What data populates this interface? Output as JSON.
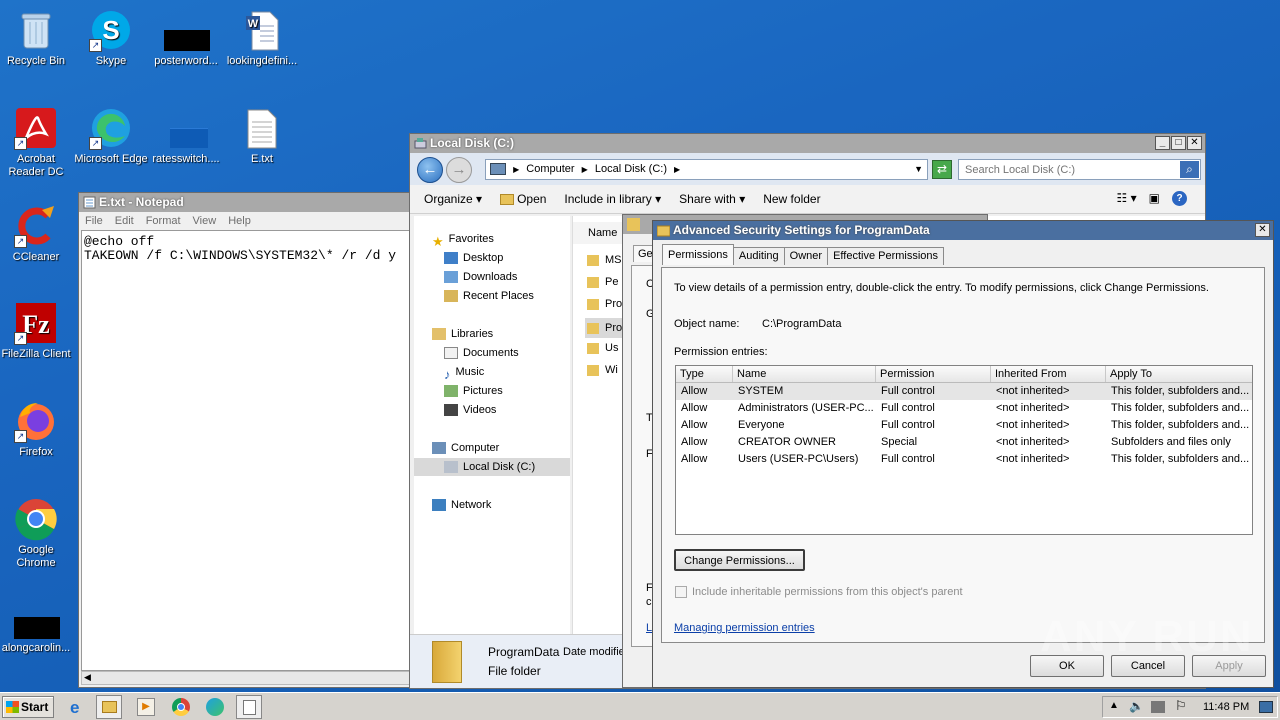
{
  "desktop_icons": [
    {
      "label": "Recycle Bin",
      "icon": "recycle-bin-icon"
    },
    {
      "label": "Skype",
      "icon": "skype-icon"
    },
    {
      "label": "posterword...",
      "icon": "redacted-file-icon"
    },
    {
      "label": "lookingdefini...",
      "icon": "word-document-icon"
    },
    {
      "label": "Acrobat Reader DC",
      "icon": "acrobat-icon"
    },
    {
      "label": "Microsoft Edge",
      "icon": "edge-icon"
    },
    {
      "label": "ratesswitch....",
      "icon": "blank-file-icon"
    },
    {
      "label": "E.txt",
      "icon": "text-file-icon"
    },
    {
      "label": "CCleaner",
      "icon": "ccleaner-icon"
    },
    {
      "label": "FileZilla Client",
      "icon": "filezilla-icon"
    },
    {
      "label": "Firefox",
      "icon": "firefox-icon"
    },
    {
      "label": "Google Chrome",
      "icon": "chrome-icon"
    },
    {
      "label": "alongcarolin...",
      "icon": "redacted-file-icon"
    }
  ],
  "notepad": {
    "title": "E.txt - Notepad",
    "menu": [
      "File",
      "Edit",
      "Format",
      "View",
      "Help"
    ],
    "content": "@echo off\nTAKEOWN /f C:\\WINDOWS\\SYSTEM32\\* /r /d y"
  },
  "explorer": {
    "title": "Local Disk (C:)",
    "breadcrumb": [
      "Computer",
      "Local Disk (C:)"
    ],
    "search_placeholder": "Search Local Disk (C:)",
    "toolbar": {
      "organize": "Organize",
      "open": "Open",
      "include": "Include in library",
      "share": "Share with",
      "new_folder": "New folder"
    },
    "nav": {
      "favorites": "Favorites",
      "desktop": "Desktop",
      "downloads": "Downloads",
      "recent": "Recent Places",
      "libraries": "Libraries",
      "documents": "Documents",
      "music": "Music",
      "pictures": "Pictures",
      "videos": "Videos",
      "computer": "Computer",
      "local_disk": "Local Disk (C:)",
      "network": "Network"
    },
    "column_name": "Name",
    "files": [
      "MS",
      "Pe",
      "Pro",
      "Pro",
      "Us",
      "Wi"
    ],
    "details": {
      "name": "ProgramData",
      "type": "File folder",
      "date_label": "Date modifie"
    }
  },
  "properties_dialog": {
    "tab": "Ge",
    "side_letters": [
      "C",
      "G",
      "T",
      "F",
      "F",
      "c",
      "L"
    ]
  },
  "security_dialog": {
    "title": "Advanced Security Settings for ProgramData",
    "tabs": [
      "Permissions",
      "Auditing",
      "Owner",
      "Effective Permissions"
    ],
    "description": "To view details of a permission entry, double-click the entry. To modify permissions, click Change Permissions.",
    "object_name_label": "Object name:",
    "object_name": "C:\\ProgramData",
    "entries_label": "Permission entries:",
    "columns": [
      "Type",
      "Name",
      "Permission",
      "Inherited From",
      "Apply To"
    ],
    "rows": [
      {
        "type": "Allow",
        "name": "SYSTEM",
        "permission": "Full control",
        "inherited": "<not inherited>",
        "apply": "This folder, subfolders and..."
      },
      {
        "type": "Allow",
        "name": "Administrators (USER-PC...",
        "permission": "Full control",
        "inherited": "<not inherited>",
        "apply": "This folder, subfolders and..."
      },
      {
        "type": "Allow",
        "name": "Everyone",
        "permission": "Full control",
        "inherited": "<not inherited>",
        "apply": "This folder, subfolders and..."
      },
      {
        "type": "Allow",
        "name": "CREATOR OWNER",
        "permission": "Special",
        "inherited": "<not inherited>",
        "apply": "Subfolders and files only"
      },
      {
        "type": "Allow",
        "name": "Users (USER-PC\\Users)",
        "permission": "Full control",
        "inherited": "<not inherited>",
        "apply": "This folder, subfolders and..."
      }
    ],
    "change_permissions": "Change Permissions...",
    "include_inheritable": "Include inheritable permissions from this object's parent",
    "managing_link": "Managing permission entries",
    "ok": "OK",
    "cancel": "Cancel",
    "apply": "Apply"
  },
  "watermark": "ANY RUN",
  "taskbar": {
    "start": "Start",
    "clock": "11:48 PM"
  }
}
